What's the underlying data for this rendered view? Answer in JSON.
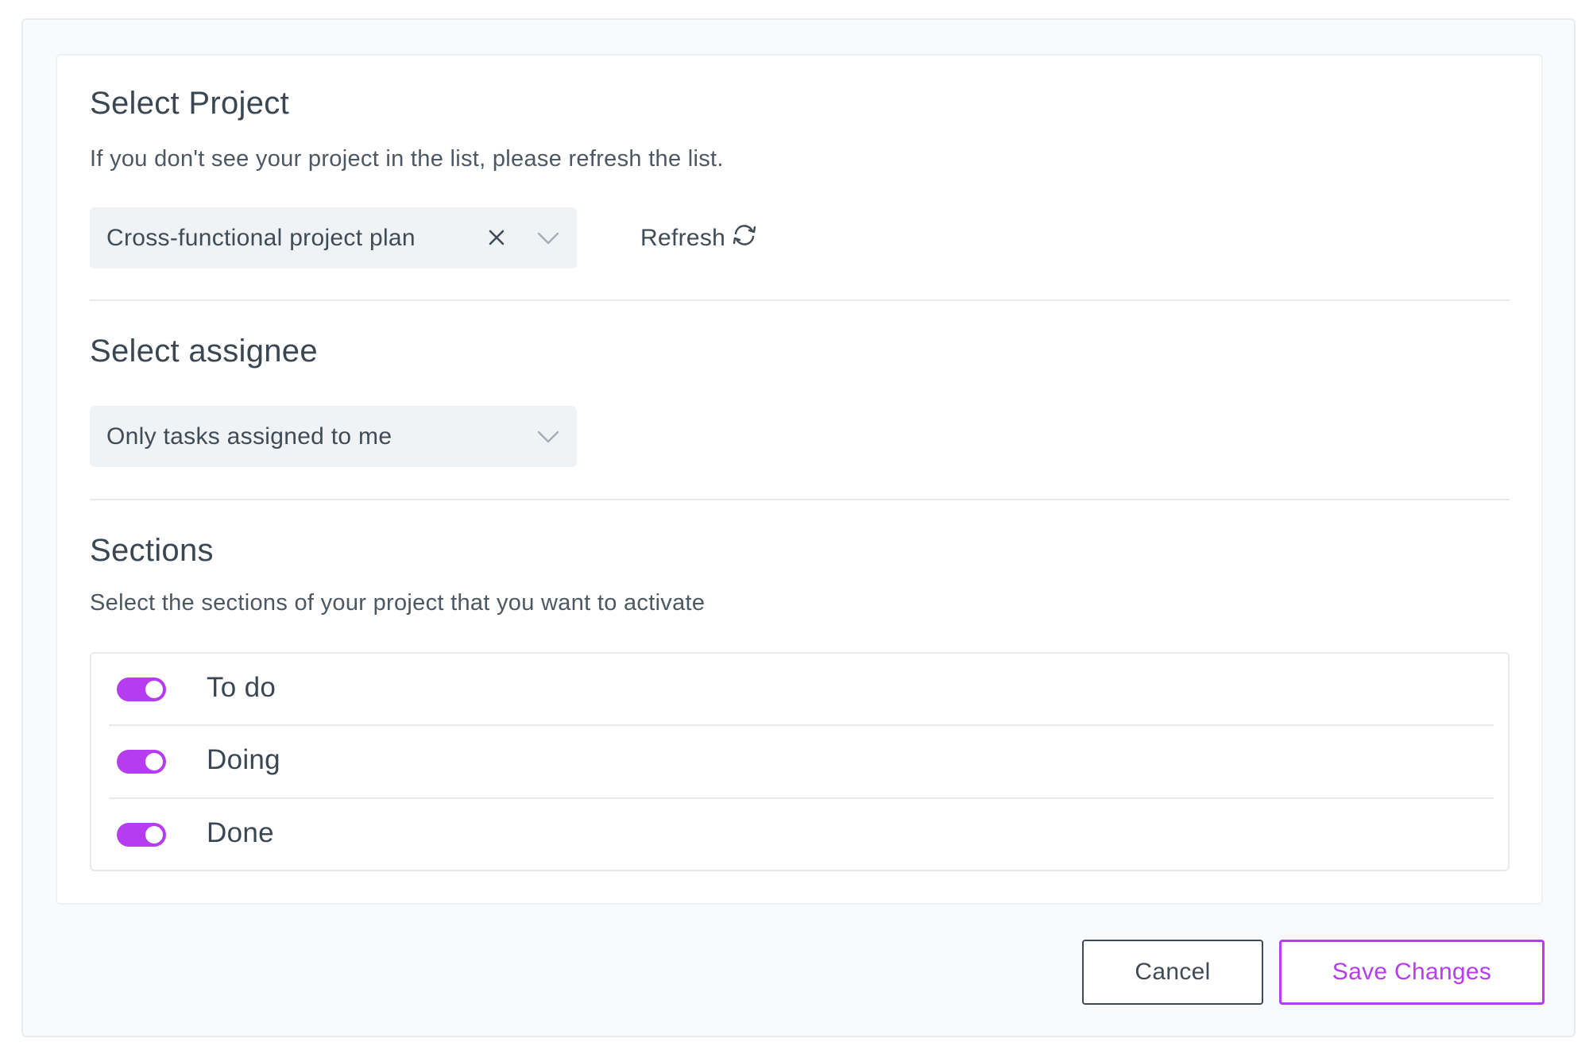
{
  "project": {
    "title": "Select Project",
    "description": "If you don't see your project in the list, please refresh the list.",
    "selected_value": "Cross-functional project plan",
    "refresh_label": "Refresh"
  },
  "assignee": {
    "title": "Select assignee",
    "selected_value": "Only tasks assigned to me"
  },
  "sections": {
    "title": "Sections",
    "description": "Select the sections of your project that you want to activate",
    "items": [
      {
        "label": "To do",
        "enabled": true
      },
      {
        "label": "Doing",
        "enabled": true
      },
      {
        "label": "Done",
        "enabled": true
      }
    ]
  },
  "footer": {
    "cancel_label": "Cancel",
    "save_label": "Save Changes"
  },
  "colors": {
    "accent": "#b53cf0",
    "text": "#3a4652",
    "field_bg": "#f0f3f5"
  }
}
